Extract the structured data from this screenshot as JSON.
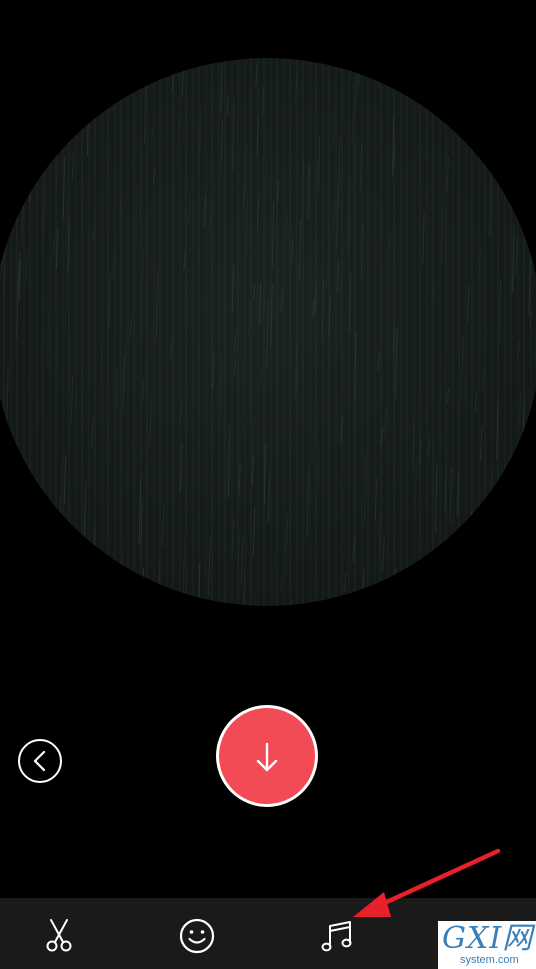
{
  "preview": {
    "shape": "circle",
    "content": "dark-rain-texture"
  },
  "controls": {
    "back_icon": "chevron-left-icon",
    "download_icon": "arrow-down-icon",
    "download_color": "#f24b55"
  },
  "toolbar": {
    "background": "#1a1a1a",
    "items": [
      {
        "icon": "scissors-icon"
      },
      {
        "icon": "smiley-icon"
      },
      {
        "icon": "music-note-icon"
      }
    ]
  },
  "annotation": {
    "arrow_color": "#e8202a",
    "points_to": "music-note-icon"
  },
  "watermark": {
    "main": "GXI网",
    "sub": "system.com"
  }
}
